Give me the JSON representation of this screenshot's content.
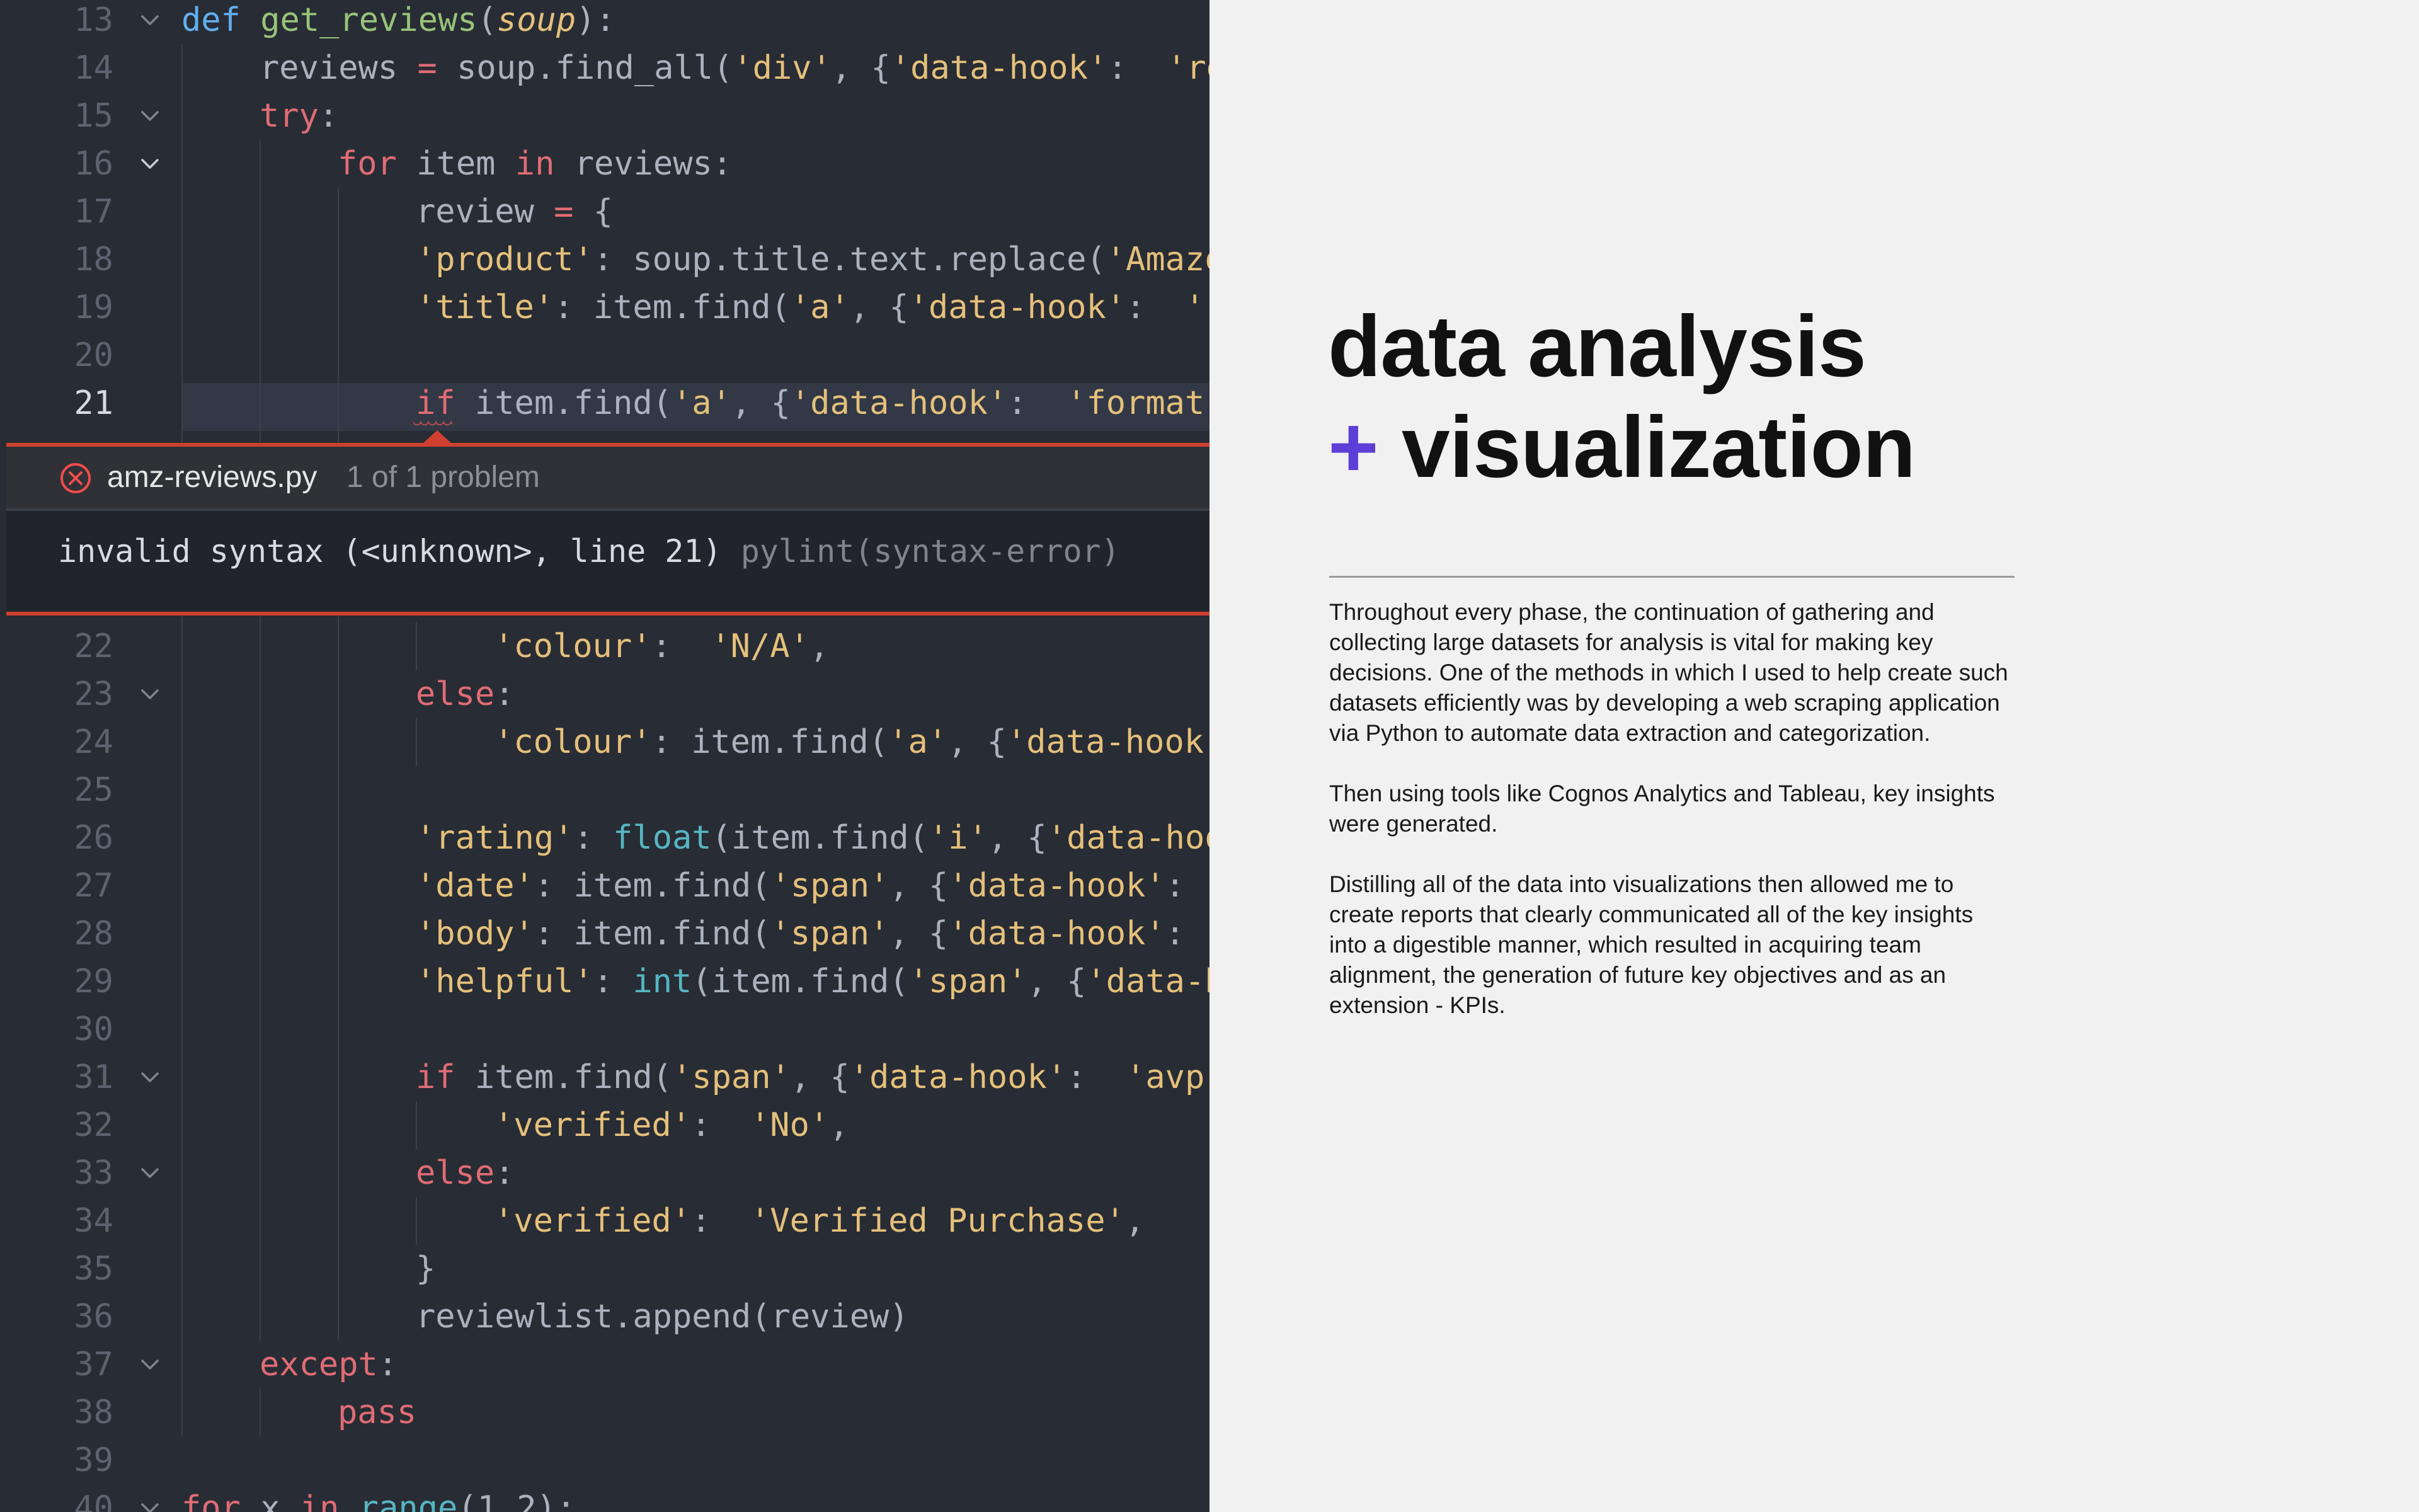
{
  "editor": {
    "lines": [
      {
        "n": "13",
        "parts": [
          [
            "def ",
            "def"
          ],
          [
            "get_reviews",
            "fname"
          ],
          [
            "(",
            ""
          ],
          [
            "soup",
            "param"
          ],
          [
            "):",
            ""
          ]
        ]
      },
      {
        "n": "14",
        "parts": [
          [
            "reviews ",
            ""
          ],
          [
            "= ",
            "kw2"
          ],
          [
            "soup.find_all(",
            ""
          ],
          [
            "'div'",
            "str"
          ],
          [
            ", {",
            ""
          ],
          [
            "'data-hook'",
            "str"
          ],
          [
            ":  ",
            ""
          ],
          [
            "'rev",
            "str"
          ]
        ]
      },
      {
        "n": "15",
        "parts": [
          [
            "try",
            "kw2"
          ],
          [
            ":",
            ""
          ]
        ]
      },
      {
        "n": "16",
        "parts": [
          [
            "for ",
            "kw2"
          ],
          [
            "item ",
            ""
          ],
          [
            "in ",
            "kw2"
          ],
          [
            "reviews:",
            ""
          ]
        ]
      },
      {
        "n": "17",
        "parts": [
          [
            "review ",
            ""
          ],
          [
            "= ",
            "kw2"
          ],
          [
            "{",
            ""
          ]
        ]
      },
      {
        "n": "18",
        "parts": [
          [
            "'product'",
            "str"
          ],
          [
            ": soup.title.text.replace(",
            ""
          ],
          [
            "'Amazo",
            "str"
          ]
        ]
      },
      {
        "n": "19",
        "parts": [
          [
            "'title'",
            "str"
          ],
          [
            ": item.find(",
            ""
          ],
          [
            "'a'",
            "str"
          ],
          [
            ", {",
            ""
          ],
          [
            "'data-hook'",
            "str"
          ],
          [
            ":  ",
            ""
          ],
          [
            "'re",
            "str"
          ]
        ]
      },
      {
        "n": "20",
        "parts": []
      },
      {
        "n": "21",
        "parts": [
          [
            "if ",
            "kw2"
          ],
          [
            "item.find(",
            ""
          ],
          [
            "'a'",
            "str"
          ],
          [
            ", {",
            ""
          ],
          [
            "'data-hook'",
            "str"
          ],
          [
            ":  ",
            ""
          ],
          [
            "'format-s",
            "str"
          ]
        ]
      },
      {
        "n": "22",
        "parts": [
          [
            "'colour'",
            "str"
          ],
          [
            ":  ",
            ""
          ],
          [
            "'N/A'",
            "str"
          ],
          [
            ",",
            ""
          ]
        ]
      },
      {
        "n": "23",
        "parts": [
          [
            "else",
            "kw2"
          ],
          [
            ":",
            ""
          ]
        ]
      },
      {
        "n": "24",
        "parts": [
          [
            "'colour'",
            "str"
          ],
          [
            ": item.find(",
            ""
          ],
          [
            "'a'",
            "str"
          ],
          [
            ", {",
            ""
          ],
          [
            "'data-hook'",
            "str"
          ]
        ]
      },
      {
        "n": "25",
        "parts": []
      },
      {
        "n": "26",
        "parts": [
          [
            "'rating'",
            "str"
          ],
          [
            ": ",
            ""
          ],
          [
            "float",
            "builtin"
          ],
          [
            "(item.find(",
            ""
          ],
          [
            "'i'",
            "str"
          ],
          [
            ", {",
            ""
          ],
          [
            "'data-hoo",
            "str"
          ]
        ]
      },
      {
        "n": "27",
        "parts": [
          [
            "'date'",
            "str"
          ],
          [
            ": item.find(",
            ""
          ],
          [
            "'span'",
            "str"
          ],
          [
            ", {",
            ""
          ],
          [
            "'data-hook'",
            "str"
          ],
          [
            ":  '",
            ""
          ]
        ]
      },
      {
        "n": "28",
        "parts": [
          [
            "'body'",
            "str"
          ],
          [
            ": item.find(",
            ""
          ],
          [
            "'span'",
            "str"
          ],
          [
            ", {",
            ""
          ],
          [
            "'data-hook'",
            "str"
          ],
          [
            ":  '",
            ""
          ]
        ]
      },
      {
        "n": "29",
        "parts": [
          [
            "'helpful'",
            "str"
          ],
          [
            ": ",
            ""
          ],
          [
            "int",
            "builtin"
          ],
          [
            "(item.find(",
            ""
          ],
          [
            "'span'",
            "str"
          ],
          [
            ", {",
            ""
          ],
          [
            "'data-h",
            "str"
          ]
        ]
      },
      {
        "n": "30",
        "parts": []
      },
      {
        "n": "31",
        "parts": [
          [
            "if ",
            "kw2"
          ],
          [
            "item.find(",
            ""
          ],
          [
            "'span'",
            "str"
          ],
          [
            ", {",
            ""
          ],
          [
            "'data-hook'",
            "str"
          ],
          [
            ":  ",
            ""
          ],
          [
            "'avp-b",
            "str"
          ]
        ]
      },
      {
        "n": "32",
        "parts": [
          [
            "'verified'",
            "str"
          ],
          [
            ":  ",
            ""
          ],
          [
            "'No'",
            "str"
          ],
          [
            ",",
            ""
          ]
        ]
      },
      {
        "n": "33",
        "parts": [
          [
            "else",
            "kw2"
          ],
          [
            ":",
            ""
          ]
        ]
      },
      {
        "n": "34",
        "parts": [
          [
            "'verified'",
            "str"
          ],
          [
            ":  ",
            ""
          ],
          [
            "'Verified Purchase'",
            "str"
          ],
          [
            ",",
            ""
          ]
        ]
      },
      {
        "n": "35",
        "parts": [
          [
            "}",
            ""
          ]
        ]
      },
      {
        "n": "36",
        "parts": [
          [
            "reviewlist.append(review)",
            ""
          ]
        ]
      },
      {
        "n": "37",
        "parts": [
          [
            "except",
            "kw2"
          ],
          [
            ":",
            ""
          ]
        ]
      },
      {
        "n": "38",
        "parts": [
          [
            "pass",
            "kw2"
          ]
        ]
      },
      {
        "n": "39",
        "parts": []
      },
      {
        "n": "40",
        "parts": [
          [
            "for ",
            "kw2"
          ],
          [
            "x ",
            ""
          ],
          [
            "in ",
            "kw2"
          ],
          [
            "range",
            "builtin"
          ],
          [
            "(1,2):",
            ""
          ]
        ]
      }
    ],
    "problem": {
      "file": "amz-reviews.py",
      "count": "1 of 1 problem",
      "message": "invalid syntax (<unknown>, line 21)",
      "source": "pylint(syntax-error)"
    }
  },
  "panel": {
    "title_line1": "data analysis",
    "title_plus": "+",
    "title_line2": "visualization",
    "paragraphs": [
      "Throughout every phase, the continuation of gathering and collecting large datasets for analysis is vital for making key decisions. One of the methods in which I used to help create such datasets efficiently was by developing a web scraping application via Python to automate data extraction and categorization.",
      "Then using tools like Cognos Analytics and Tableau, key insights were generated.",
      "Distilling all of the data into visualizations then allowed me to create reports that clearly communicated all of the key insights into a digestible manner, which resulted in acquiring team alignment, the generation of future key objectives and as an extension - KPIs."
    ],
    "accent_color": "#5b3fd6"
  }
}
